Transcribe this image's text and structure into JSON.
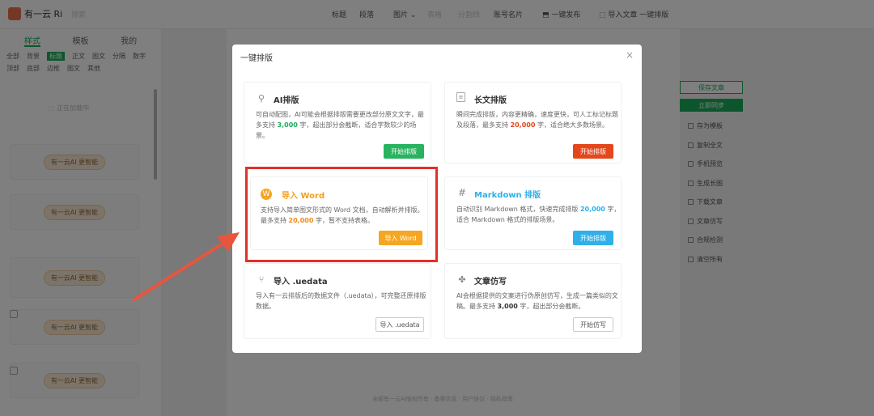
{
  "app": {
    "logo_text": "有一云 Ri",
    "search_hint": "搜索"
  },
  "topnav": {
    "items": [
      "标题",
      "段落",
      "图片 ⌄",
      "表格",
      "分割线",
      "账号名片"
    ],
    "one_click_publish": "一键发布",
    "import_article": "导入文章 一键排版"
  },
  "left_panel": {
    "tabs": [
      "样式",
      "模板",
      "我的"
    ],
    "categories": [
      "全部",
      "背景",
      "标题",
      "正文",
      "图文",
      "分隔",
      "数字",
      "顶部",
      "底部",
      "边框",
      "图文",
      "其他"
    ],
    "placeholder": "正在加载中",
    "templates": [
      "有一云AI 更智能",
      "有一云AI 更智能",
      "有一云AI 更智能",
      "有一云AI 更智能",
      "有一云AI 更智能"
    ]
  },
  "right_panel": {
    "save": "保存文章",
    "publish": "立即同步",
    "items": [
      "存为模板",
      "复制全文",
      "手机预览",
      "生成长图",
      "下载文章",
      "文章仿写",
      "合规检测",
      "清空所有"
    ]
  },
  "footer": "全部有一云AI版权所有 · 备案信息 · 用户协议 · 隐私政策",
  "modal": {
    "title": "一键排版",
    "close": "×",
    "cards": [
      {
        "title": "AI排版",
        "icon": "magic-wand-icon",
        "desc_pre": "可自动配图，AI可能会根据排版需要更改部分原文文字，最多支持 ",
        "desc_num": "3,000",
        "desc_post": " 字，超出部分会截断，适合字数较少的场景。",
        "button": "开始排版"
      },
      {
        "title": "长文排版",
        "icon": "document-icon",
        "desc_pre": "瞬间完成排版，内容更精确，速度更快，可人工标记标题及段落，最多支持 ",
        "desc_num": "20,000",
        "desc_post": " 字，适合绝大多数场景。",
        "button": "开始排版"
      },
      {
        "title": "导入 Word",
        "icon": "wordpress-icon",
        "desc_pre": "支持导入简单图文形式的 Word 文档，自动解析并排版。最多支持 ",
        "desc_num": "20,000",
        "desc_post": " 字，暂不支持表格。",
        "button": "导入 Word"
      },
      {
        "title": "Markdown 排版",
        "icon": "hash-icon",
        "desc_pre": "自动识别 Markdown 格式，快速完成排版 ",
        "desc_num": "20,000",
        "desc_post": " 字，适合 Markdown 格式的排版场景。",
        "button": "开始排版"
      },
      {
        "title": "导入 .uedata",
        "icon": "branch-icon",
        "desc_pre": "导入有一云排版后的数据文件（.uedata），可完整还原排版数据。",
        "desc_num": "",
        "desc_post": "",
        "button": "导入 .uedata"
      },
      {
        "title": "文章仿写",
        "icon": "nodes-icon",
        "desc_pre": "AI会根据提供的文案进行伪原创仿写，生成一篇类似的文稿。最多支持 ",
        "desc_num": "3,000",
        "desc_post": " 字，超出部分会截断。",
        "button": "开始仿写"
      }
    ]
  },
  "colors": {
    "brand_green": "#1aad5b",
    "ai_btn": "#27b35f",
    "long_btn": "#e4471c",
    "word_btn": "#f5a623",
    "md_btn": "#2fb0e8",
    "highlight_red": "#e0312b",
    "num_green": "#1aad5b",
    "num_orange": "#f08c1a",
    "num_blue": "#2fb0e8"
  }
}
